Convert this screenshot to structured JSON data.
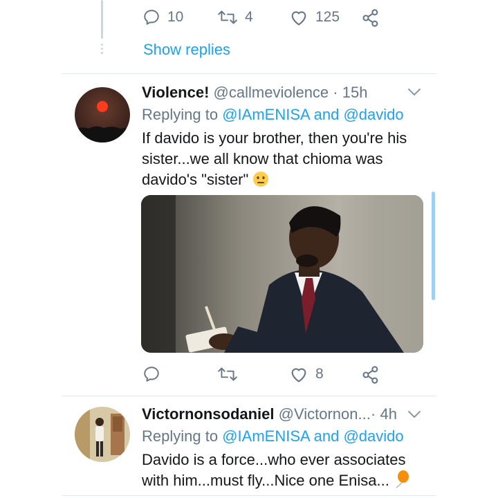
{
  "top_tweet": {
    "actions": {
      "replies": "10",
      "retweets": "4",
      "likes": "125"
    },
    "show_replies": "Show replies"
  },
  "tweet1": {
    "name": "Violence!",
    "handle": "@callmeviolence",
    "separator": "·",
    "time": "15h",
    "replying_prefix": "Replying to",
    "replying_user1": "@IAmENISA",
    "replying_and": "and",
    "replying_user2": "@davido",
    "text": "If davido is your brother, then you're his sister...we all know that chioma was davido's \"sister\"",
    "emoji": "neutral-face-emoji",
    "actions": {
      "replies": "",
      "retweets": "",
      "likes": "8"
    }
  },
  "tweet2": {
    "name": "Victornonsodaniel",
    "handle": "@Victornon...",
    "separator": "·",
    "time": "4h",
    "replying_prefix": "Replying to",
    "replying_user1": "@IAmENISA",
    "replying_and": "and",
    "replying_user2": "@davido",
    "text": "Davido is a force...who ever associates with him...must fly...Nice one Enisa...",
    "emoji": "balloon-emoji"
  },
  "colors": {
    "accent": "#1da1f2",
    "muted": "#657786",
    "divider": "#e1e8ed"
  }
}
